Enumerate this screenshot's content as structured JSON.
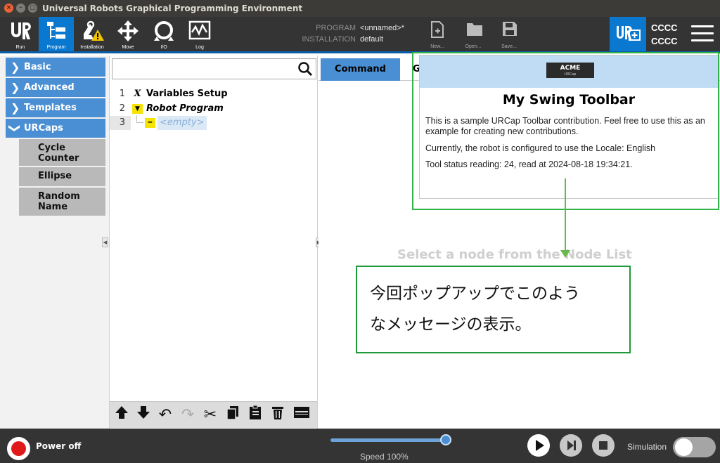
{
  "window": {
    "title": "Universal Robots Graphical Programming Environment",
    "close_glyph": "×",
    "min_glyph": "–",
    "max_glyph": "□"
  },
  "toolbar": {
    "tools": [
      {
        "label": "Run",
        "icon": "ur-logo-icon"
      },
      {
        "label": "Program",
        "icon": "program-tree-icon",
        "active": true
      },
      {
        "label": "Installation",
        "icon": "installation-warning-icon"
      },
      {
        "label": "Move",
        "icon": "move-arrows-icon"
      },
      {
        "label": "I/O",
        "icon": "io-icon"
      },
      {
        "label": "Log",
        "icon": "log-chart-icon"
      }
    ],
    "program_key": "PROGRAM",
    "program_value": "<unnamed>*",
    "installation_key": "INSTALLATION",
    "installation_value": "default",
    "file_buttons": [
      {
        "label": "New...",
        "icon": "new-file-icon"
      },
      {
        "label": "Open...",
        "icon": "open-folder-icon"
      },
      {
        "label": "Save...",
        "icon": "save-disk-icon"
      }
    ],
    "urplus_icon": "urcap-plus-icon",
    "cccc_line1": "CCCC",
    "cccc_line2": "CCCC",
    "menu_icon": "hamburger-menu-icon"
  },
  "left_panel": {
    "categories": [
      {
        "label": "Basic",
        "chevron": "❯"
      },
      {
        "label": "Advanced",
        "chevron": "❯"
      },
      {
        "label": "Templates",
        "chevron": "❯"
      },
      {
        "label": "URCaps",
        "chevron": "❯"
      }
    ],
    "urcaps_items": [
      "Cycle Counter",
      "Ellipse",
      "Random Name"
    ]
  },
  "program_tree": {
    "search_placeholder": "",
    "rows": [
      {
        "num": "1",
        "icon": "X",
        "label": "Variables Setup"
      },
      {
        "num": "2",
        "icon": "▼",
        "label": "Robot Program"
      },
      {
        "num": "3",
        "icon": "━",
        "label": "<empty>"
      }
    ],
    "bottom_tools": [
      {
        "name": "move-up-icon",
        "glyph": "🡅"
      },
      {
        "name": "move-down-icon",
        "glyph": "🡇"
      },
      {
        "name": "undo-icon",
        "glyph": "↶"
      },
      {
        "name": "redo-icon",
        "glyph": "↷"
      },
      {
        "name": "cut-icon",
        "glyph": "✂"
      },
      {
        "name": "copy-icon",
        "glyph": "❐"
      },
      {
        "name": "paste-icon",
        "glyph": "📋"
      },
      {
        "name": "delete-icon",
        "glyph": "🗑"
      },
      {
        "name": "suppress-icon",
        "glyph": "▤"
      }
    ]
  },
  "right_panel": {
    "tabs": [
      {
        "label": "Command"
      },
      {
        "label": "G"
      }
    ],
    "node_hint": "Select a node from the Node List"
  },
  "popup": {
    "logo_text": "ACME",
    "logo_sub": "URCap",
    "title": "My Swing Toolbar",
    "para1": "This is a sample URCap Toolbar contribution. Feel free to use this as an example for creating new contributions.",
    "para2": "Currently, the robot is configured to use the Locale: English",
    "para3": "Tool status reading: 24, read at 2024-08-18 19:34:21."
  },
  "callout": {
    "line1": "今回ポップアップでこのよう",
    "line2": "なメッセージの表示。"
  },
  "footer": {
    "power_label": "Power off",
    "speed_label": "Speed 100%",
    "speed_value": 1.0,
    "simulation_label": "Simulation",
    "simulation_on": false
  },
  "colors": {
    "accent": "#0b78d0",
    "category": "#4a8fd4",
    "callout_border": "#1e9a3a",
    "popup_border": "#33b24a"
  }
}
